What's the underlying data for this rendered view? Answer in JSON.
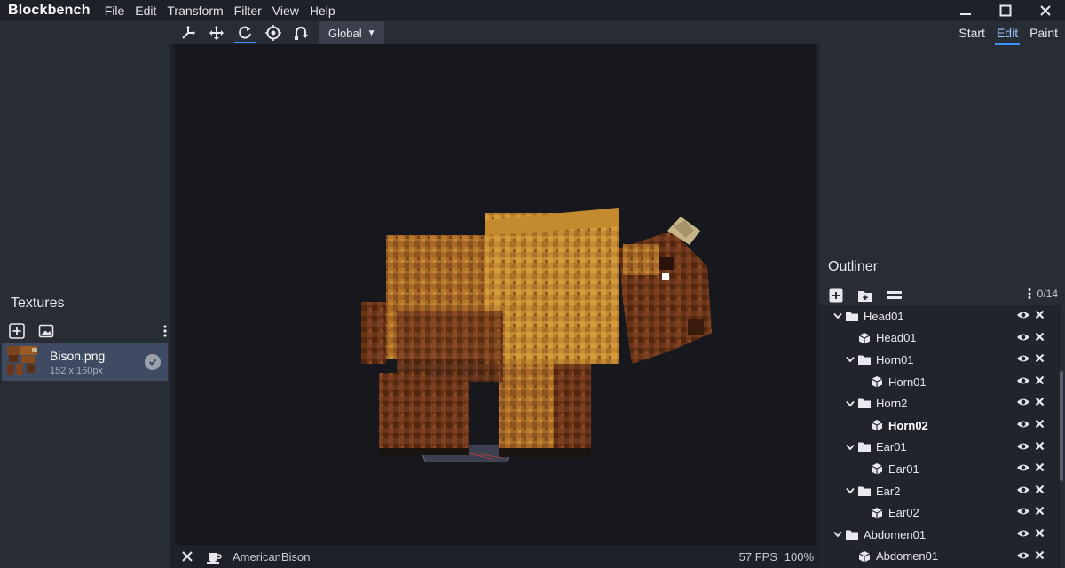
{
  "app": {
    "title": "Blockbench"
  },
  "menu": [
    "File",
    "Edit",
    "Transform",
    "Filter",
    "View",
    "Help"
  ],
  "toolbar": {
    "tools": [
      "move-icon",
      "resize-icon",
      "rotate-icon",
      "pivot-icon",
      "vertex-snap-icon"
    ],
    "active_tool": "rotate-icon",
    "space": "Global"
  },
  "modes": [
    {
      "label": "Start",
      "active": false
    },
    {
      "label": "Edit",
      "active": true
    },
    {
      "label": "Paint",
      "active": false
    }
  ],
  "textures": {
    "title": "Textures",
    "items": [
      {
        "name": "Bison.png",
        "size": "152 x 160px"
      }
    ]
  },
  "outliner": {
    "title": "Outliner",
    "count": "0/14",
    "rows": [
      {
        "label": "Head01",
        "type": "group",
        "depth": 0,
        "selected": false
      },
      {
        "label": "Head01",
        "type": "cube",
        "depth": 1,
        "selected": false
      },
      {
        "label": "Horn01",
        "type": "group",
        "depth": 1,
        "selected": false
      },
      {
        "label": "Horn01",
        "type": "cube",
        "depth": 2,
        "selected": false
      },
      {
        "label": "Horn2",
        "type": "group",
        "depth": 1,
        "selected": false
      },
      {
        "label": "Horn02",
        "type": "cube",
        "depth": 2,
        "selected": true
      },
      {
        "label": "Ear01",
        "type": "group",
        "depth": 1,
        "selected": false
      },
      {
        "label": "Ear01",
        "type": "cube",
        "depth": 2,
        "selected": false
      },
      {
        "label": "Ear2",
        "type": "group",
        "depth": 1,
        "selected": false
      },
      {
        "label": "Ear02",
        "type": "cube",
        "depth": 2,
        "selected": false
      },
      {
        "label": "Abdomen01",
        "type": "group",
        "depth": 0,
        "selected": false
      },
      {
        "label": "Abdomen01",
        "type": "cube",
        "depth": 1,
        "selected": false
      }
    ]
  },
  "status": {
    "model_name": "AmericanBison",
    "fps": "57 FPS",
    "zoom": "100%"
  },
  "colors": {
    "accent": "#3e90ff",
    "viewport_bg": "#16181d",
    "panel_bg": "#282c34",
    "selected_texture_bg": "#3e4b62"
  }
}
